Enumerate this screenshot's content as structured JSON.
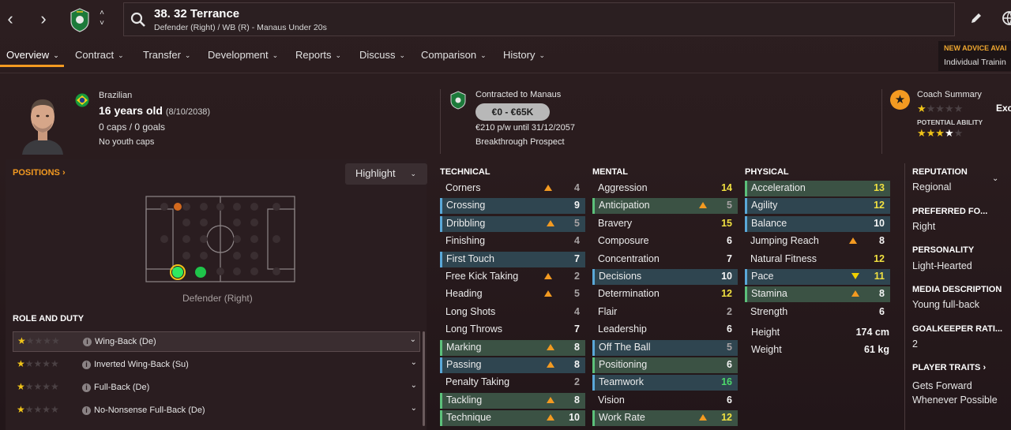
{
  "header": {
    "title": "38. 32 Terrance",
    "subtitle": "Defender (Right) / WB (R) - Manaus Under 20s",
    "advice_title": "NEW ADVICE AVAI",
    "advice_sub": "Individual Trainin"
  },
  "tabs": [
    {
      "label": "Overview"
    },
    {
      "label": "Contract"
    },
    {
      "label": "Transfer"
    },
    {
      "label": "Development"
    },
    {
      "label": "Reports"
    },
    {
      "label": "Discuss"
    },
    {
      "label": "Comparison"
    },
    {
      "label": "History"
    }
  ],
  "info": {
    "nationality": "Brazilian",
    "age": "16 years old",
    "dob": "(8/10/2038)",
    "caps": "0 caps / 0 goals",
    "youth_caps": "No youth caps",
    "contracted_to": "Contracted to Manaus",
    "value": "€0 - €65K",
    "wage": "€210 p/w until 31/12/2057",
    "status": "Breakthrough Prospect",
    "coach_summary": "Coach Summary",
    "coach_verdict": "Exciting",
    "potential_label": "POTENTIAL ABILITY"
  },
  "positions": {
    "heading": "POSITIONS ›",
    "highlight": "Highlight",
    "caption": "Defender (Right)"
  },
  "roles": {
    "heading": "ROLE AND DUTY",
    "items": [
      {
        "name": "Wing-Back (De)"
      },
      {
        "name": "Inverted Wing-Back (Su)"
      },
      {
        "name": "Full-Back (De)"
      },
      {
        "name": "No-Nonsense Full-Back (De)"
      }
    ]
  },
  "attributes": {
    "technical_heading": "TECHNICAL",
    "mental_heading": "MENTAL",
    "physical_heading": "PHYSICAL",
    "technical": [
      {
        "label": "Corners",
        "value": "4"
      },
      {
        "label": "Crossing",
        "value": "9"
      },
      {
        "label": "Dribbling",
        "value": "5"
      },
      {
        "label": "Finishing",
        "value": "4"
      },
      {
        "label": "First Touch",
        "value": "7"
      },
      {
        "label": "Free Kick Taking",
        "value": "2"
      },
      {
        "label": "Heading",
        "value": "5"
      },
      {
        "label": "Long Shots",
        "value": "4"
      },
      {
        "label": "Long Throws",
        "value": "7"
      },
      {
        "label": "Marking",
        "value": "8"
      },
      {
        "label": "Passing",
        "value": "8"
      },
      {
        "label": "Penalty Taking",
        "value": "2"
      },
      {
        "label": "Tackling",
        "value": "8"
      },
      {
        "label": "Technique",
        "value": "10"
      }
    ],
    "mental": [
      {
        "label": "Aggression",
        "value": "14"
      },
      {
        "label": "Anticipation",
        "value": "5"
      },
      {
        "label": "Bravery",
        "value": "15"
      },
      {
        "label": "Composure",
        "value": "6"
      },
      {
        "label": "Concentration",
        "value": "7"
      },
      {
        "label": "Decisions",
        "value": "10"
      },
      {
        "label": "Determination",
        "value": "12"
      },
      {
        "label": "Flair",
        "value": "2"
      },
      {
        "label": "Leadership",
        "value": "6"
      },
      {
        "label": "Off The Ball",
        "value": "5"
      },
      {
        "label": "Positioning",
        "value": "6"
      },
      {
        "label": "Teamwork",
        "value": "16"
      },
      {
        "label": "Vision",
        "value": "6"
      },
      {
        "label": "Work Rate",
        "value": "12"
      }
    ],
    "physical": [
      {
        "label": "Acceleration",
        "value": "13"
      },
      {
        "label": "Agility",
        "value": "12"
      },
      {
        "label": "Balance",
        "value": "10"
      },
      {
        "label": "Jumping Reach",
        "value": "8"
      },
      {
        "label": "Natural Fitness",
        "value": "12"
      },
      {
        "label": "Pace",
        "value": "11"
      },
      {
        "label": "Stamina",
        "value": "8"
      },
      {
        "label": "Strength",
        "value": "6"
      }
    ],
    "height_label": "Height",
    "height": "174 cm",
    "weight_label": "Weight",
    "weight": "61 kg"
  },
  "sidebar": {
    "reputation_head": "REPUTATION",
    "reputation": "Regional",
    "foot_head": "PREFERRED FO...",
    "foot": "Right",
    "personality_head": "PERSONALITY",
    "personality": "Light-Hearted",
    "media_head": "MEDIA DESCRIPTION",
    "media": "Young full-back",
    "gk_head": "GOALKEEPER RATI...",
    "gk": "2",
    "traits_head": "PLAYER TRAITS ›",
    "trait1": "Gets Forward",
    "trait2": "Whenever Possible"
  },
  "colors": {
    "accent": "#f39a21",
    "value_yellow": "#f0e040",
    "value_green": "#4dd86a",
    "highlight_blue": "#2f4550",
    "highlight_green": "#3b5244"
  }
}
